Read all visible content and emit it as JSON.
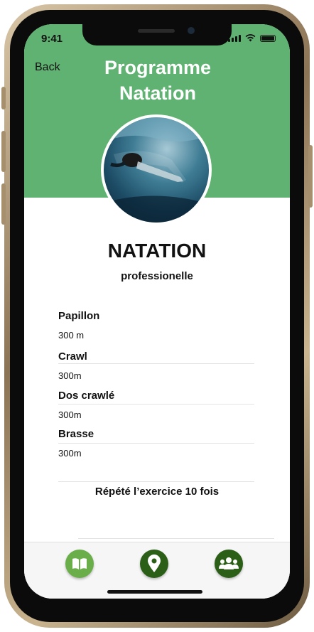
{
  "status_bar": {
    "time": "9:41"
  },
  "header": {
    "back_label": "Back",
    "title_line1": "Programme",
    "title_line2": "Natation",
    "background_color": "#5fb271"
  },
  "sport": {
    "name": "NATATION",
    "level": "professionelle"
  },
  "exercises": [
    {
      "name": "Papillon",
      "distance": "300 m"
    },
    {
      "name": "Crawl",
      "distance": "300m"
    },
    {
      "name": "Dos crawlé",
      "distance": "300m"
    },
    {
      "name": "Brasse",
      "distance": "300m"
    }
  ],
  "repeat_text": "Répété l’exercice 10 fois",
  "tabbar": {
    "items": [
      {
        "icon": "book-icon",
        "color": "#6aae4a"
      },
      {
        "icon": "map-pin-icon",
        "color": "#2b5e16"
      },
      {
        "icon": "users-group-icon",
        "color": "#2b5e16"
      }
    ]
  }
}
